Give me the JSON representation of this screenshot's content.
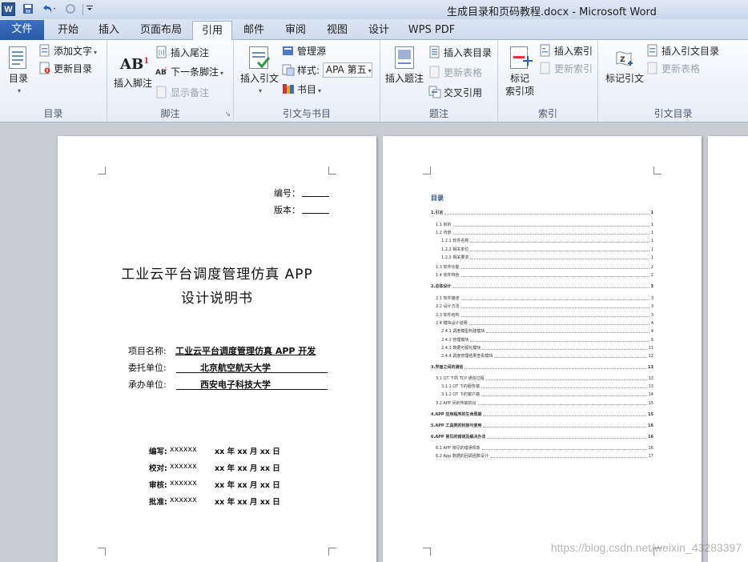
{
  "window": {
    "title": "生成目录和页码教程.docx  -  Microsoft Word",
    "app_icon": "W",
    "quick_access": [
      "save-icon",
      "undo-icon",
      "redo-icon",
      "customize-icon"
    ]
  },
  "tabs": {
    "file": "文件",
    "items": [
      "开始",
      "插入",
      "页面布局",
      "引用",
      "邮件",
      "审阅",
      "视图",
      "设计",
      "WPS PDF"
    ],
    "active": "引用"
  },
  "ribbon": {
    "toc": {
      "label": "目录",
      "toc_button": "目录",
      "add_text": "添加文字",
      "update_toc": "更新目录"
    },
    "footnotes": {
      "label": "脚注",
      "insert_footnote": "插入脚注",
      "insert_endnote": "插入尾注",
      "next_footnote": "下一条脚注",
      "show_notes": "显示备注"
    },
    "citations": {
      "label": "引文与书目",
      "insert_citation": "插入引文",
      "manage_sources": "管理源",
      "style_label": "样式:",
      "style_value": "APA 第五",
      "bibliography": "书目"
    },
    "captions": {
      "label": "题注",
      "insert_caption": "插入题注",
      "insert_table_of_figures": "插入表目录",
      "update_table": "更新表格",
      "cross_reference": "交叉引用"
    },
    "index": {
      "label": "索引",
      "mark_entry": "标记\n索引项",
      "insert_index": "插入索引",
      "update_index": "更新索引"
    },
    "toa": {
      "label": "引文目录",
      "mark_citation": "标记引文",
      "insert_toa": "插入引文目录",
      "update_table": "更新表格"
    }
  },
  "page1": {
    "number_label": "编号：",
    "version_label": "版本：",
    "title_line1": "工业云平台调度管理仿真 APP",
    "title_line2": "设计说明书",
    "project_label": "项目名称:",
    "project_value": "工业云平台调度管理仿真 APP 开发",
    "client_label": "委托单位:",
    "client_value": "北京航空航天大学",
    "contractor_label": "承办单位:",
    "contractor_value": "西安电子科技大学",
    "signatures": [
      {
        "role": "编写:",
        "name": "xxxxxx",
        "date": "xx 年 xx 月 xx 日"
      },
      {
        "role": "校对:",
        "name": "xxxxxx",
        "date": "xx 年 xx 月 xx 日"
      },
      {
        "role": "审核:",
        "name": "xxxxxx",
        "date": "xx 年 xx 月 xx 日"
      },
      {
        "role": "批准:",
        "name": "xxxxxx",
        "date": "xx 年 xx 月 xx 日"
      }
    ]
  },
  "page2": {
    "toc_title": "目录",
    "entries": [
      {
        "text": "1.引言",
        "page": "1",
        "level": 1
      },
      {
        "text": "1.1 目的",
        "page": "1",
        "level": 2
      },
      {
        "text": "1.2 背景",
        "page": "1",
        "level": 2
      },
      {
        "text": "1.2.1 软件名称",
        "page": "1",
        "level": 3
      },
      {
        "text": "1.2.2 相关单位",
        "page": "1",
        "level": 3
      },
      {
        "text": "1.2.3 相关要求",
        "page": "1",
        "level": 3
      },
      {
        "text": "1.3 软件功能",
        "page": "2",
        "level": 2
      },
      {
        "text": "1.4 软件特色",
        "page": "2",
        "level": 2
      },
      {
        "text": "2.总体设计",
        "page": "3",
        "level": 1
      },
      {
        "text": "2.1 软件描述",
        "page": "3",
        "level": 2
      },
      {
        "text": "2.2 设计方法",
        "page": "3",
        "level": 2
      },
      {
        "text": "2.3 软件结构",
        "page": "3",
        "level": 2
      },
      {
        "text": "2.4 模块设计说明",
        "page": "4",
        "level": 2
      },
      {
        "text": "2.4.1 调度模型构建模块",
        "page": "4",
        "level": 3
      },
      {
        "text": "2.4.2 管理模块",
        "page": "6",
        "level": 3
      },
      {
        "text": "2.4.3 数据可视化模块",
        "page": "11",
        "level": 3
      },
      {
        "text": "2.4.4 调度管理结果查看模块",
        "page": "12",
        "level": 3
      },
      {
        "text": "3.界面之间的通信",
        "page": "13",
        "level": 1
      },
      {
        "text": "3.1 QT 下的 TCP 通信过程",
        "page": "13",
        "level": 2
      },
      {
        "text": "3.1.1 QT 下的服务端",
        "page": "13",
        "level": 3
      },
      {
        "text": "3.1.2 QT 下的客户端",
        "page": "14",
        "level": 3
      },
      {
        "text": "3.2 APP 间的传输协议",
        "page": "15",
        "level": 2
      },
      {
        "text": "4.APP 应用程序的生命周期",
        "page": "15",
        "level": 1
      },
      {
        "text": "5.APP 工具类的封装与使用",
        "page": "16",
        "level": 1
      },
      {
        "text": "6.APP 常见的错误及解决办法",
        "page": "16",
        "level": 1
      },
      {
        "text": "6.1 APP 常见的错误现象",
        "page": "16",
        "level": 2
      },
      {
        "text": "6.2 App 数据的回调函数设计",
        "page": "17",
        "level": 2
      }
    ]
  },
  "watermark": "https://blog.csdn.net/weixin_43283397"
}
